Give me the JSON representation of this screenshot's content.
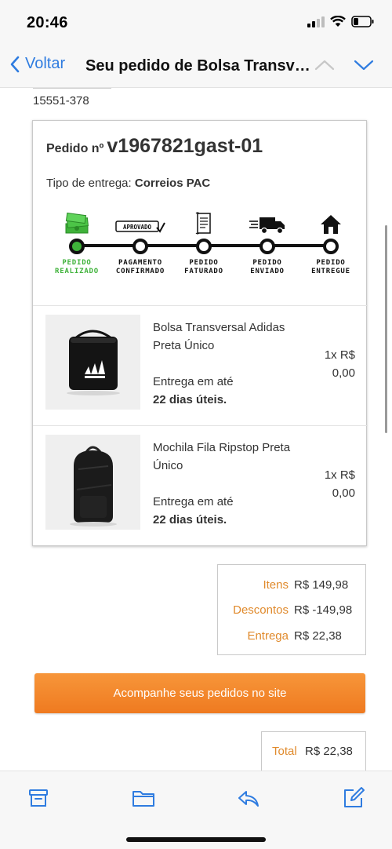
{
  "status_bar": {
    "time": "20:46"
  },
  "nav": {
    "back_label": "Voltar",
    "title": "Seu pedido de Bolsa Transversal Adidas Preta Único"
  },
  "email": {
    "reference": "15551-378",
    "order": {
      "label": "Pedido nº",
      "number": "v1967821gast-01",
      "delivery_type_label": "Tipo de entrega:",
      "delivery_type_value": "Correios PAC"
    },
    "tracker": {
      "steps": [
        {
          "icon": "stack-of-money-icon",
          "line1": "PEDIDO",
          "line2": "REALIZADO",
          "done": true
        },
        {
          "icon": "approved-stamp-icon",
          "stamp_text": "APROVADO",
          "line1": "PAGAMENTO",
          "line2": "CONFIRMADO",
          "done": false
        },
        {
          "icon": "invoice-icon",
          "line1": "PEDIDO",
          "line2": "FATURADO",
          "done": false
        },
        {
          "icon": "delivery-truck-icon",
          "line1": "PEDIDO",
          "line2": "ENVIADO",
          "done": false
        },
        {
          "icon": "house-icon",
          "line1": "PEDIDO",
          "line2": "ENTREGUE",
          "done": false
        }
      ],
      "done_color": "#3fb23a"
    },
    "products": [
      {
        "name": "Bolsa Transversal Adidas Preta Único",
        "price_line1": "1x R$",
        "price_line2": "0,00",
        "delivery_line1": "Entrega em até",
        "delivery_line2": "22 dias úteis.",
        "image_icon": "shoulder-bag-image"
      },
      {
        "name": "Mochila Fila Ripstop Preta Único",
        "price_line1": "1x R$",
        "price_line2": "0,00",
        "delivery_line1": "Entrega em até",
        "delivery_line2": "22 dias úteis.",
        "image_icon": "backpack-image"
      }
    ],
    "totals": {
      "items_label": "Itens",
      "items_value": "R$ 149,98",
      "discounts_label": "Descontos",
      "discounts_value": "R$ -149,98",
      "shipping_label": "Entrega",
      "shipping_value": "R$ 22,38"
    },
    "cta_label": "Acompanhe seus pedidos no site",
    "total": {
      "label": "Total",
      "value": "R$ 22,38"
    },
    "colors": {
      "accent_orange": "#ef7a20",
      "label_orange": "#e08a2c",
      "link_blue": "#2f7ce0"
    }
  },
  "toolbar": {
    "icons": [
      "archive-icon",
      "folder-icon",
      "reply-icon",
      "compose-icon"
    ]
  }
}
